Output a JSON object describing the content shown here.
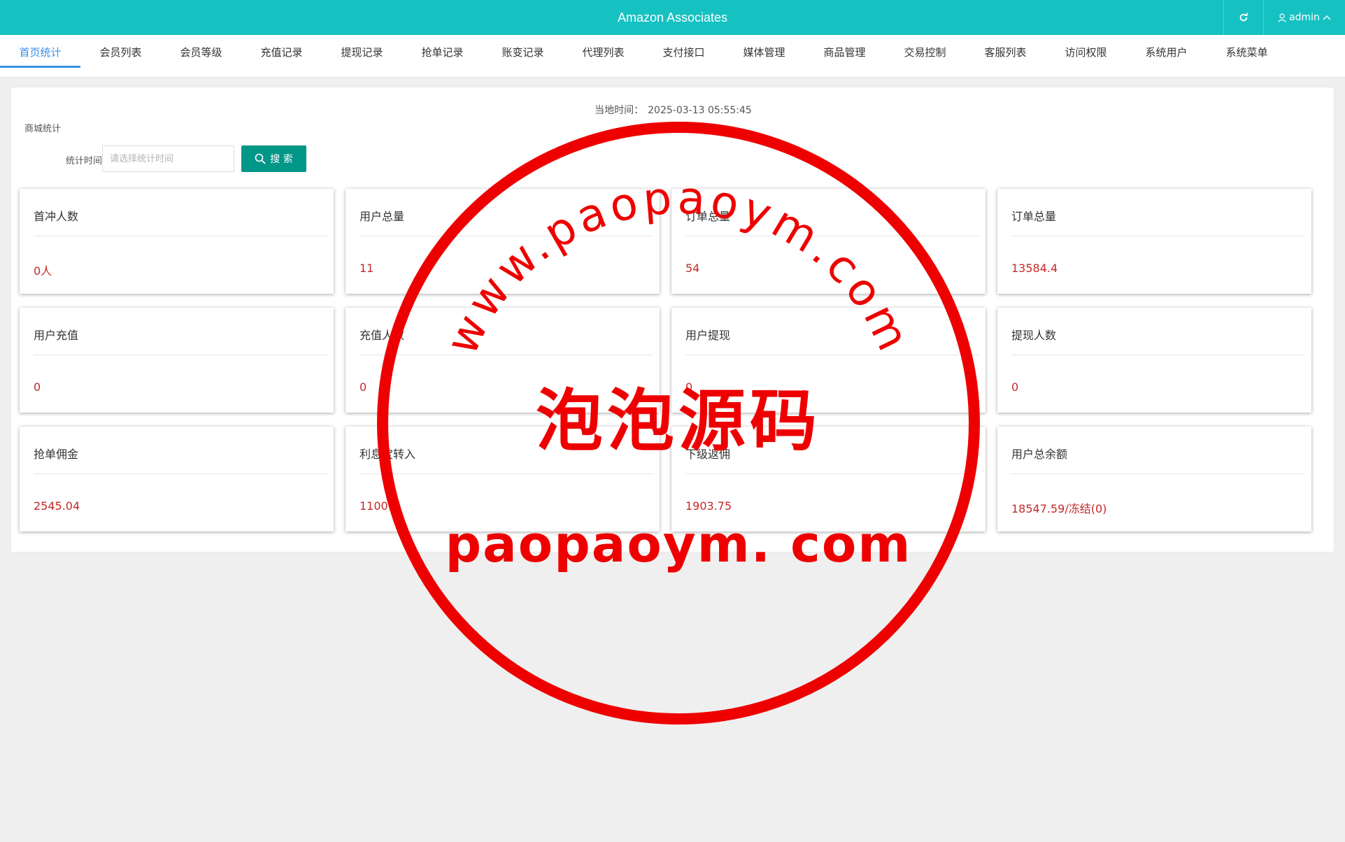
{
  "app": {
    "title": "Amazon Associates",
    "user": "admin"
  },
  "colors": {
    "header_bg": "#16c1c2",
    "active_tab": "#3a8ee6",
    "value_red": "#c62828",
    "search_btn": "#009688",
    "watermark": "#ee0000"
  },
  "icons": {
    "refresh": "refresh-icon",
    "user": "user-icon",
    "chevron": "chevron-up-icon",
    "search": "search-icon"
  },
  "nav": {
    "tabs": [
      {
        "label": "首页统计",
        "active": true
      },
      {
        "label": "会员列表"
      },
      {
        "label": "会员等级"
      },
      {
        "label": "充值记录"
      },
      {
        "label": "提现记录"
      },
      {
        "label": "抢单记录"
      },
      {
        "label": "账变记录"
      },
      {
        "label": "代理列表"
      },
      {
        "label": "支付接口"
      },
      {
        "label": "媒体管理"
      },
      {
        "label": "商品管理"
      },
      {
        "label": "交易控制"
      },
      {
        "label": "客服列表"
      },
      {
        "label": "访问权限"
      },
      {
        "label": "系统用户"
      },
      {
        "label": "系统菜单"
      }
    ]
  },
  "panel": {
    "time_label": "当地时间：",
    "time_value": "2025-03-13 05:55:45",
    "section_title": "商城统计",
    "filter": {
      "label": "统计时间",
      "placeholder": "请选择统计时间",
      "value": ""
    },
    "search_label": "搜 索"
  },
  "cards": [
    {
      "title": "首冲人数",
      "value": "0人"
    },
    {
      "title": "用户总量",
      "value": "11"
    },
    {
      "title": "订单总量",
      "value": "54"
    },
    {
      "title": "订单总量",
      "value": "13584.4"
    },
    {
      "title": "用户充值",
      "value": "0"
    },
    {
      "title": "充值人数",
      "value": "0"
    },
    {
      "title": "用户提现",
      "value": "0"
    },
    {
      "title": "提现人数",
      "value": "0"
    },
    {
      "title": "抢单佣金",
      "value": "2545.04"
    },
    {
      "title": "利息宝转入",
      "value": "1100"
    },
    {
      "title": "下级返佣",
      "value": "1903.75"
    },
    {
      "title": "用户总余额",
      "value": "18547.59/冻结(0)"
    }
  ],
  "watermark": {
    "top_arc": "www.paopaoym.com",
    "center": "泡泡源码",
    "bottom": "paopaoym. com"
  }
}
